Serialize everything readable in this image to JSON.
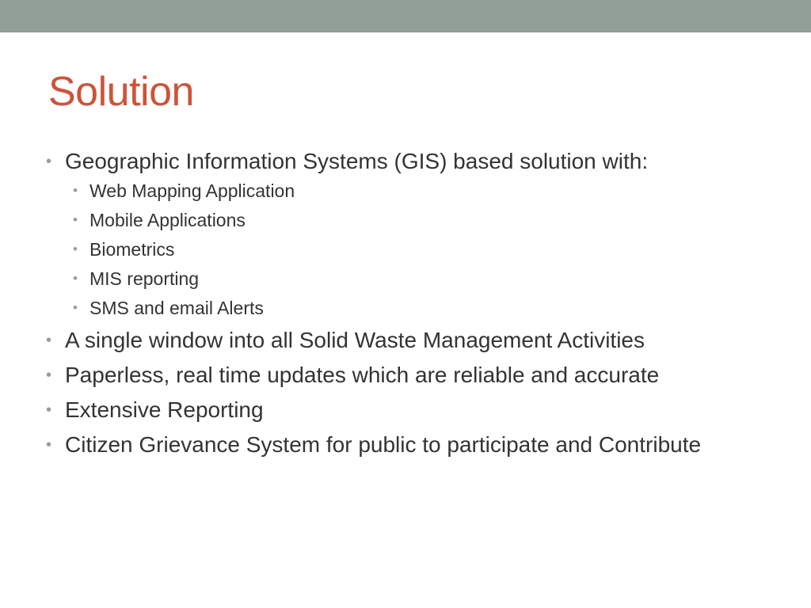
{
  "slide": {
    "title": "Solution",
    "colors": {
      "top_bar": "#919f98",
      "title": "#cd533a",
      "body_text": "#333333",
      "bullet_marker": "#919f98"
    },
    "bullets": [
      {
        "text": "Geographic Information Systems (GIS) based solution with:",
        "sub_bullets": [
          "Web Mapping Application",
          "Mobile Applications",
          "Biometrics",
          "MIS reporting",
          "SMS and email Alerts"
        ]
      },
      {
        "text": "A single window into all Solid Waste Management Activities"
      },
      {
        "text": "Paperless, real time updates which are reliable and accurate"
      },
      {
        "text": "Extensive Reporting"
      },
      {
        "text": "Citizen Grievance System for public to participate and Contribute"
      }
    ]
  }
}
